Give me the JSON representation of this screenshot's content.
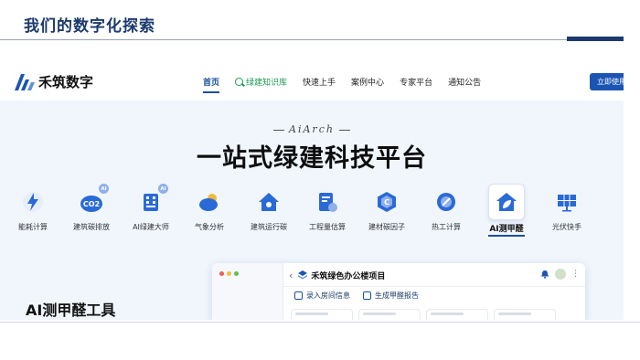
{
  "slide": {
    "title": "我们的数字化探索"
  },
  "brand": {
    "name": "禾筑数字"
  },
  "nav": {
    "items": [
      {
        "label": "首页",
        "state": "active"
      },
      {
        "label": "绿建知识库",
        "state": "highlight",
        "icon": "search-icon"
      },
      {
        "label": "快速上手",
        "state": ""
      },
      {
        "label": "案例中心",
        "state": ""
      },
      {
        "label": "专家平台",
        "state": ""
      },
      {
        "label": "通知公告",
        "state": ""
      }
    ],
    "cta_label": "立即使用"
  },
  "hero": {
    "tagline": "AiArch",
    "title": "一站式绿建科技平台"
  },
  "tools": [
    {
      "label": "能耗计算",
      "icon": "energy-bolt-icon",
      "ai": false
    },
    {
      "label": "建筑碳排放",
      "icon": "co2-cloud-icon",
      "ai": true
    },
    {
      "label": "AI绿建大师",
      "icon": "building-grid-icon",
      "ai": true
    },
    {
      "label": "气象分析",
      "icon": "weather-cloud-icon",
      "ai": false
    },
    {
      "label": "建筑运行碳",
      "icon": "house-operation-icon",
      "ai": false
    },
    {
      "label": "工程量估算",
      "icon": "document-clock-icon",
      "ai": false
    },
    {
      "label": "建材碳因子",
      "icon": "hexagon-c-icon",
      "ai": false
    },
    {
      "label": "热工计算",
      "icon": "thermal-gauge-icon",
      "ai": false
    },
    {
      "label": "AI测甲醛",
      "icon": "leaf-house-icon",
      "ai": false,
      "active": true
    },
    {
      "label": "光伏快手",
      "icon": "solar-panel-icon",
      "ai": false
    }
  ],
  "side_heading": "AI测甲醛工具",
  "app": {
    "project_title": "禾筑绿色办公楼项目",
    "actions": [
      {
        "label": "录入房间信息",
        "icon": "room-input-icon"
      },
      {
        "label": "生成甲醛报告",
        "icon": "report-icon"
      }
    ]
  },
  "colors": {
    "accent": "#1a4fa0",
    "title": "#1c3a6e",
    "green": "#1e9a52",
    "cta": "#1b55b4"
  }
}
